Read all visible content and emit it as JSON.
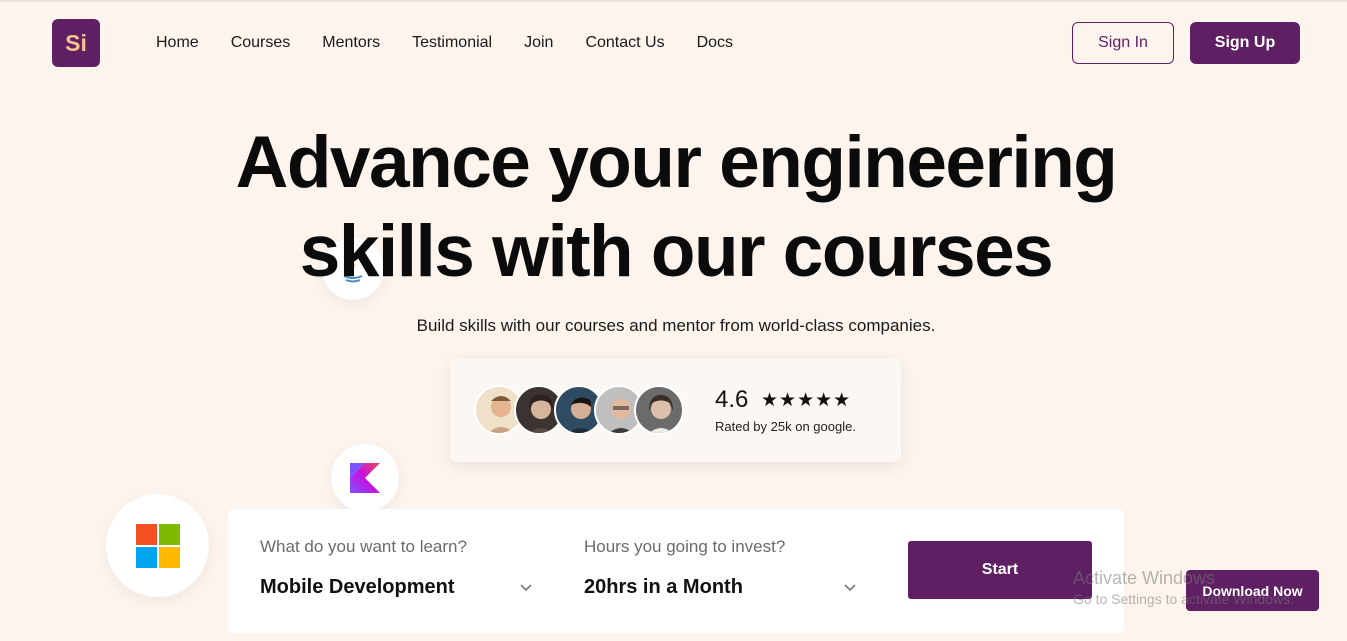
{
  "header": {
    "logo_text": "Si",
    "nav": [
      "Home",
      "Courses",
      "Mentors",
      "Testimonial",
      "Join",
      "Contact Us",
      "Docs"
    ],
    "sign_in": "Sign In",
    "sign_up": "Sign Up"
  },
  "hero": {
    "title_line1": "Advance your engineering",
    "title_line2": "skills with our courses",
    "subtitle": "Build skills with our courses and mentor from world-class companies."
  },
  "rating": {
    "value": "4.6",
    "stars": "★★★★★",
    "caption": "Rated by 25k on google."
  },
  "search": {
    "learn_label": "What do you want to learn?",
    "learn_value": "Mobile Development",
    "hours_label": "Hours you going to invest?",
    "hours_value": "20hrs in a Month",
    "start": "Start"
  },
  "download": "Download Now",
  "os_watermark": {
    "line1": "Activate Windows",
    "line2": "Go to Settings to activate Windows."
  },
  "colors": {
    "brand": "#5f1f63",
    "background": "#fdf4ee",
    "logo_text": "#f7c28e"
  }
}
